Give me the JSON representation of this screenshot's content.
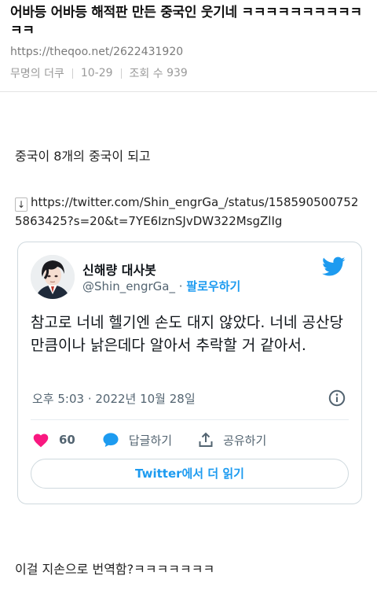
{
  "post": {
    "title": "어바등 어바등 해적판 만든 중국인 웃기네 ㅋㅋㅋㅋㅋㅋㅋㅋㅋㅋㅋㅋ",
    "url": "https://theqoo.net/2622431920",
    "author": "무명의 더쿠",
    "date": "10-29",
    "views_label": "조회 수",
    "views": "939"
  },
  "body": {
    "line1": "중국이 8개의 중국이 되고",
    "arrow": "↓",
    "link": "https://twitter.com/Shin_engrGa_/status/1585905007525863425?s=20&t=7YE6IznSJvDW322MsgZlIg",
    "line2": "이걸 지손으로 번역함?ㅋㅋㅋㅋㅋㅋㅋ"
  },
  "tweet": {
    "name": "신해량 대사봇",
    "handle": "@Shin_engrGa_",
    "dot": "·",
    "follow": "팔로우하기",
    "text": "참고로 너네 헬기엔 손도 대지 않았다. 너네 공산당만큼이나 낡은데다 알아서 추락할 거 같아서.",
    "time": "오후 5:03 · 2022년 10월 28일",
    "likes": "60",
    "reply": "답글하기",
    "share": "공유하기",
    "read_more": "Twitter에서 더 읽기"
  },
  "colors": {
    "twitter_blue": "#1d9bf0",
    "heart": "#f91880"
  },
  "icons": [
    "twitter-bird-icon",
    "info-icon",
    "heart-icon",
    "reply-bubble-icon",
    "share-icon",
    "avatar"
  ]
}
